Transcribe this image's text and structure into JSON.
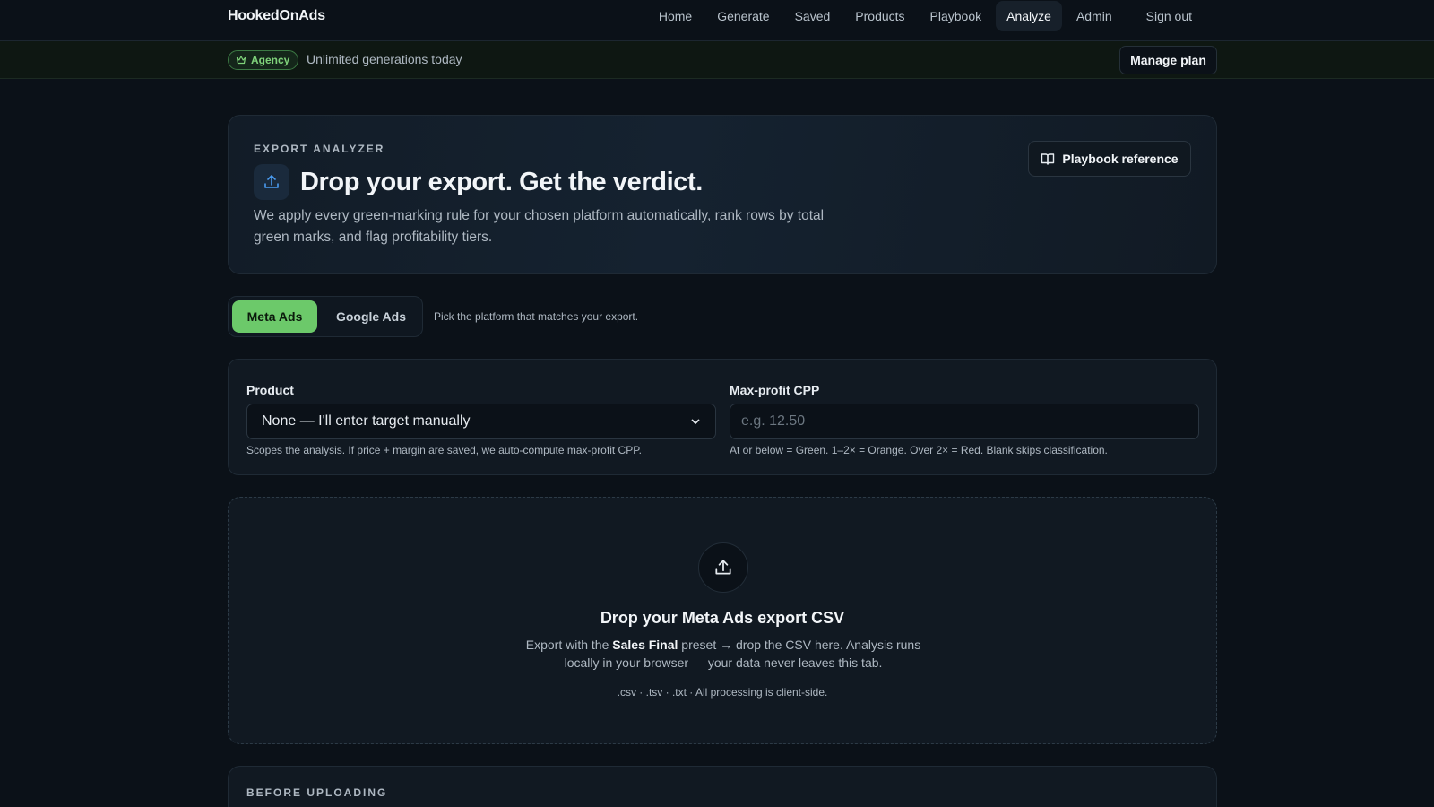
{
  "brand": "HookedOnAds",
  "nav": {
    "home": "Home",
    "generate": "Generate",
    "saved": "Saved",
    "products": "Products",
    "playbook": "Playbook",
    "analyze": "Analyze",
    "admin": "Admin",
    "signout": "Sign out",
    "active": "Analyze"
  },
  "plan": {
    "badge": "Agency",
    "status": "Unlimited generations today",
    "manage_label": "Manage plan"
  },
  "hero": {
    "eyebrow": "EXPORT ANALYZER",
    "title": "Drop your export. Get the verdict.",
    "description": "We apply every green-marking rule for your chosen platform automatically, rank rows by total green marks, and flag profitability tiers.",
    "playbook_label": "Playbook reference"
  },
  "platform": {
    "tabs": [
      "Meta Ads",
      "Google Ads"
    ],
    "selected": "Meta Ads",
    "hint": "Pick the platform that matches your export."
  },
  "settings": {
    "product_label": "Product",
    "product_value": "None — I'll enter target manually",
    "product_help": "Scopes the analysis. If price + margin are saved, we auto-compute max-profit CPP.",
    "cpp_label": "Max-profit CPP",
    "cpp_placeholder": "e.g. 12.50",
    "cpp_help": "At or below = Green. 1–2× = Orange. Over 2× = Red. Blank skips classification."
  },
  "dropzone": {
    "title": "Drop your Meta Ads export CSV",
    "desc_prefix": "Export with the ",
    "desc_bold": "Sales Final",
    "desc_suffix": " preset → drop the CSV here. Analysis runs locally in your browser — your data never leaves this tab.",
    "formats": ".csv · .tsv · .txt · All processing is client-side."
  },
  "before": {
    "title": "BEFORE UPLOADING"
  },
  "colors": {
    "background": "#0b1118",
    "accent_green": "#6cc96a",
    "badge_green": "#7fd27a",
    "icon_blue": "#4a9bf0"
  }
}
